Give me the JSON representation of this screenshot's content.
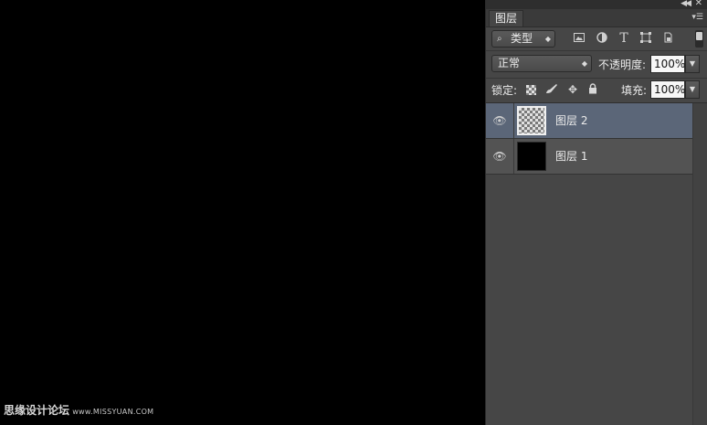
{
  "panel": {
    "tab_label": "图层",
    "filter": {
      "value": "类型",
      "icons": [
        "image-filter-icon",
        "adjustment-filter-icon",
        "type-filter-icon",
        "shape-filter-icon",
        "smart-object-filter-icon"
      ]
    },
    "blend_mode": "正常",
    "opacity_label": "不透明度:",
    "opacity_value": "100%",
    "lock_label": "锁定:",
    "fill_label": "填充:",
    "fill_value": "100%",
    "layers": [
      {
        "name": "图层 2",
        "selected": true,
        "thumbnail": "transparent"
      },
      {
        "name": "图层 1",
        "selected": false,
        "thumbnail": "black"
      }
    ]
  },
  "watermark": {
    "text_cn": "思缘设计论坛",
    "url": "www.MISSYUAN.COM"
  },
  "colors": {
    "panel_bg": "#464646",
    "selected_layer": "#5b6678",
    "canvas": "#000000"
  }
}
